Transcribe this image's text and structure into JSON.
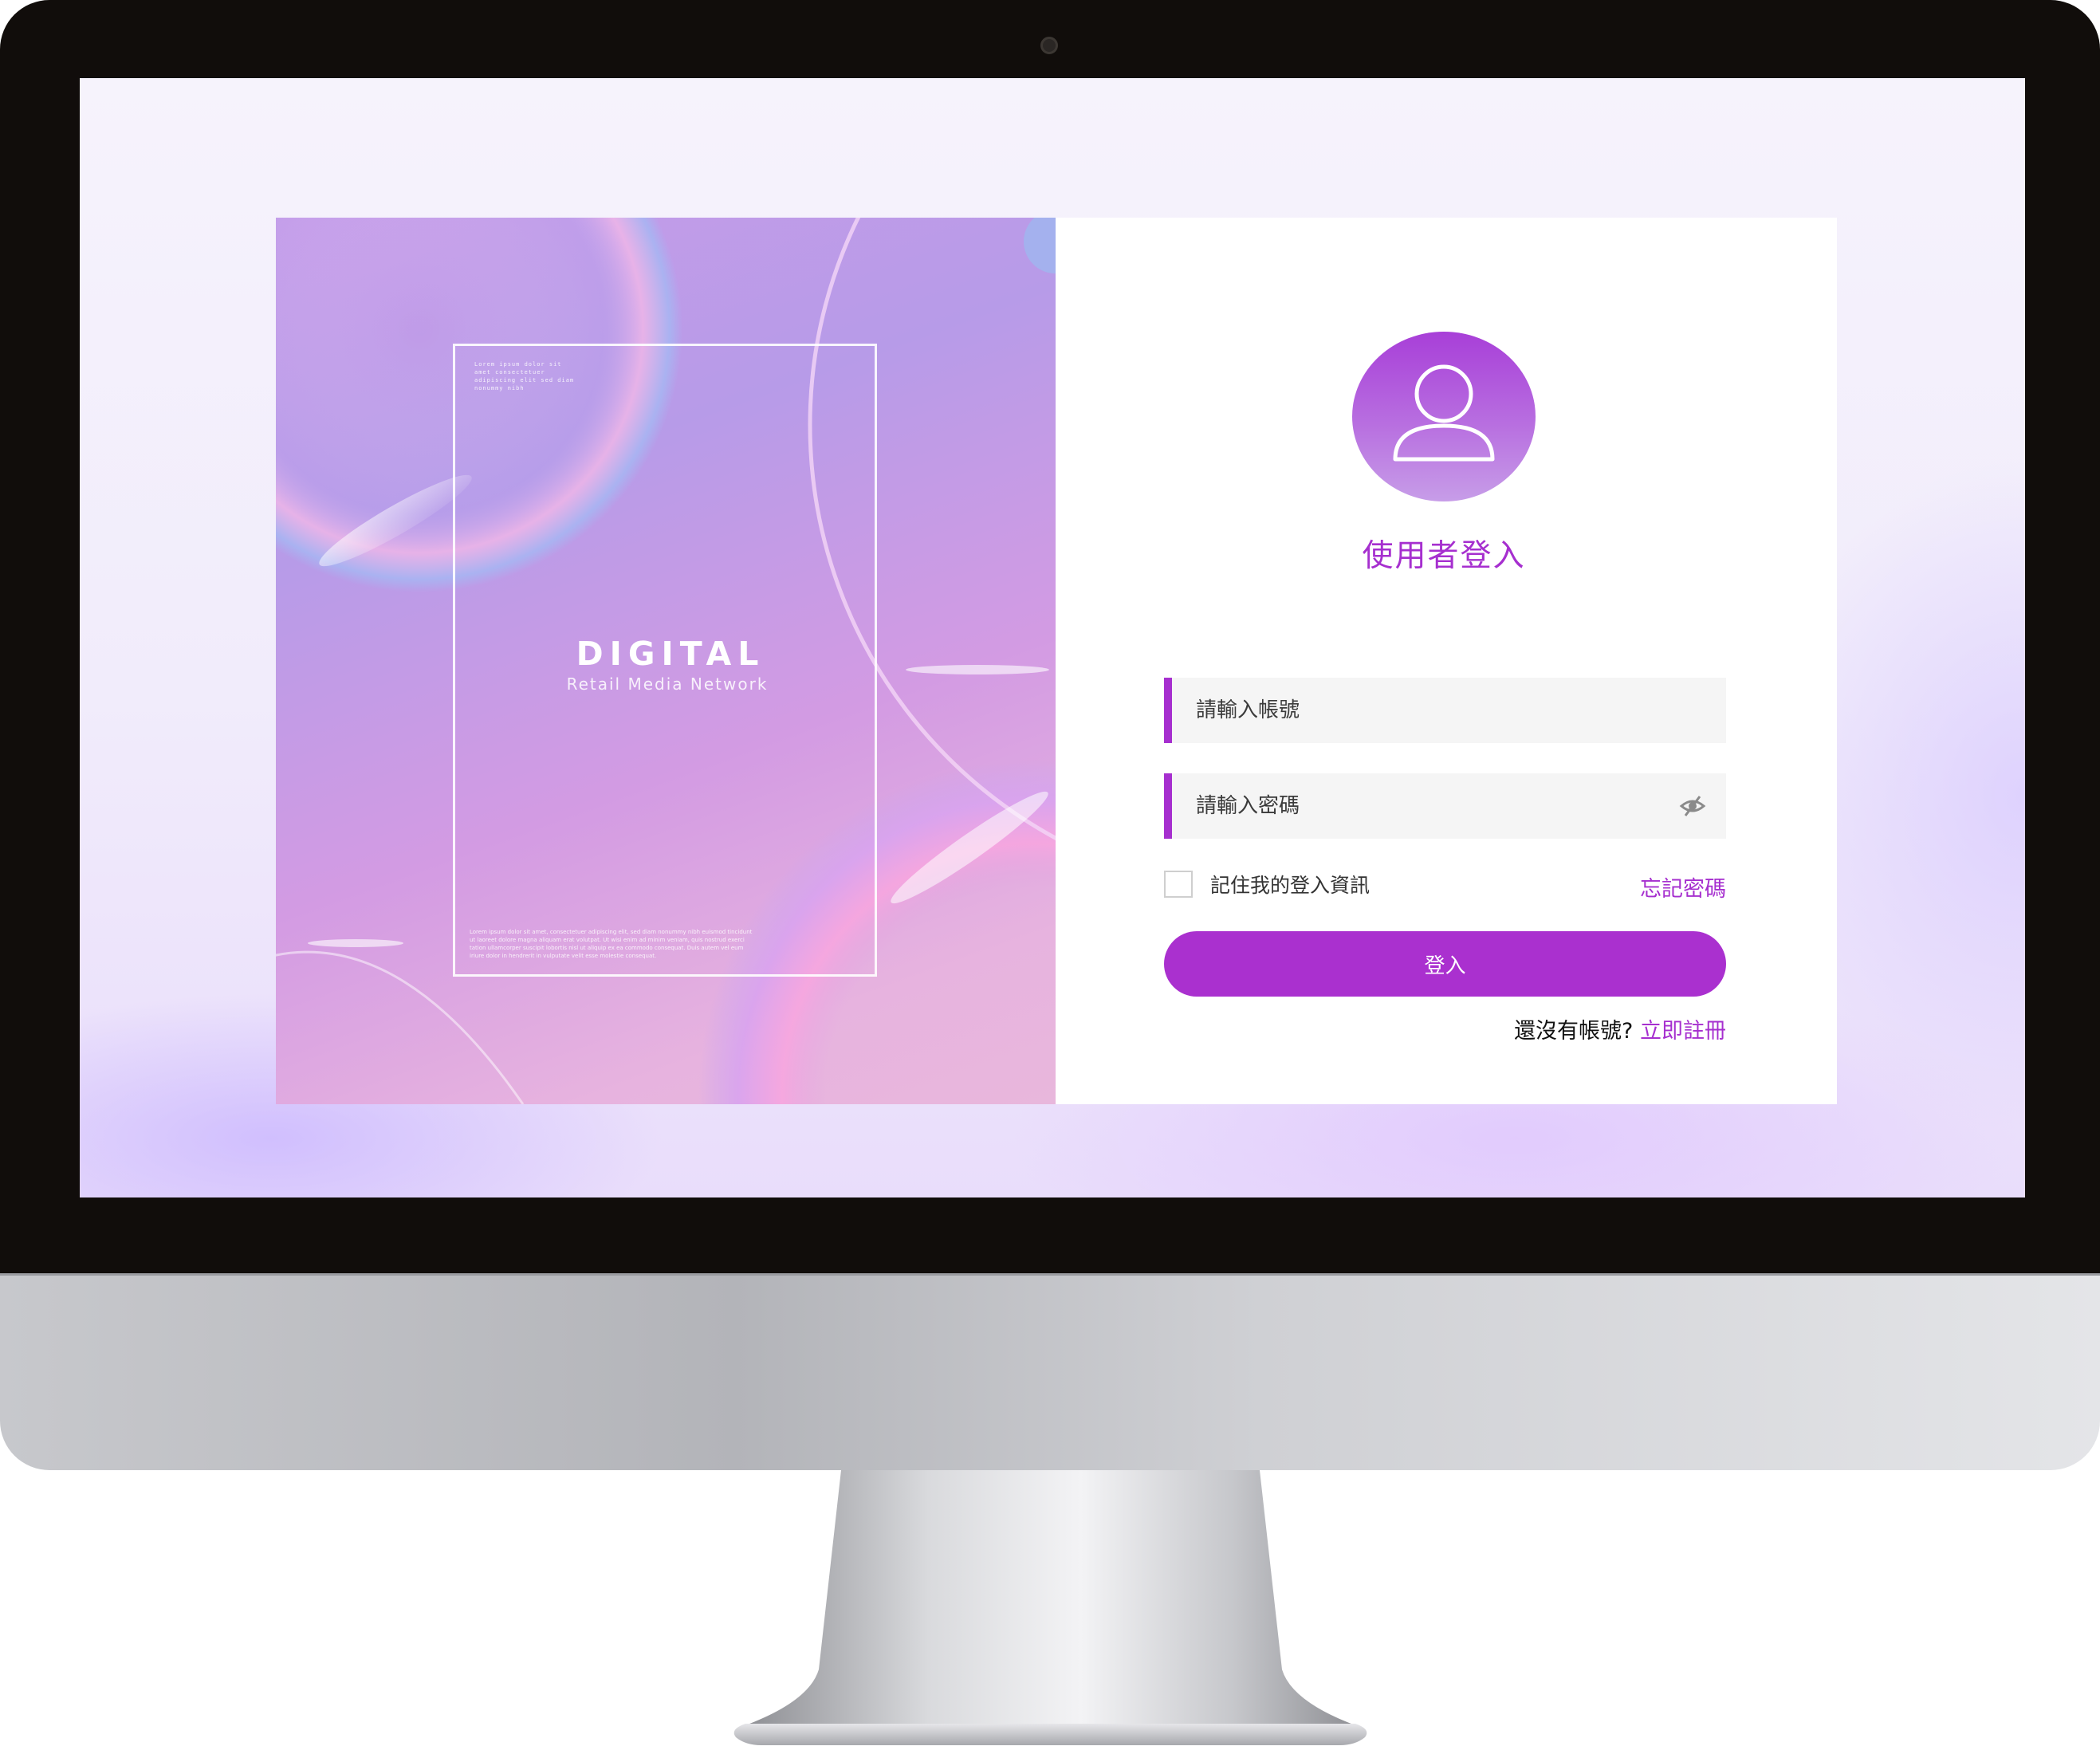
{
  "art_panel": {
    "title": "DIGITAL",
    "subtitle": "Retail Media Network",
    "fine_print_top": "Lorem ipsum dolor sit amet consectetuer adipiscing elit sed diam nonummy nibh",
    "fine_print_bottom": "Lorem ipsum dolor sit amet, consectetuer adipiscing elit, sed diam nonummy nibh euismod tincidunt ut laoreet dolore magna aliquam erat volutpat. Ut wisi enim ad minim veniam, quis nostrud exerci tation ullamcorper suscipit lobortis nisl ut aliquip ex ea commodo consequat. Duis autem vel eum iriure dolor in hendrerit in vulputate velit esse molestie consequat."
  },
  "login": {
    "title": "使用者登入",
    "username_placeholder": "請輸入帳號",
    "password_placeholder": "請輸入密碼",
    "remember_label": "記住我的登入資訊",
    "forgot_label": "忘記密碼",
    "submit_label": "登入",
    "register_question": "還沒有帳號?",
    "register_link": "立即註冊"
  },
  "colors": {
    "accent": "#aa30cf",
    "field_bg": "#f5f5f5",
    "bezel": "#110d0b"
  },
  "icons": {
    "avatar": "user-icon",
    "password_toggle": "eye-slash-icon",
    "camera": "camera-icon"
  }
}
